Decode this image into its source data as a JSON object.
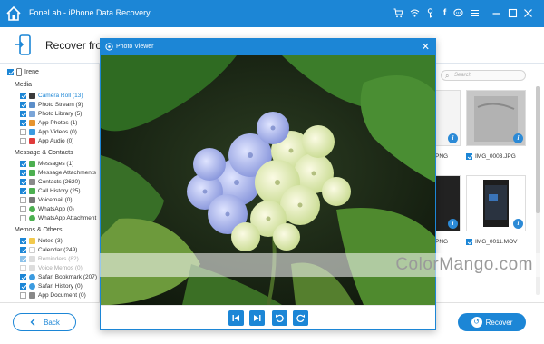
{
  "app": {
    "title": "FoneLab - iPhone Data Recovery"
  },
  "header": {
    "title": "Recover from"
  },
  "device": {
    "name": "Irene"
  },
  "sidebar": {
    "sections": [
      {
        "title": "Media",
        "items": [
          {
            "label": "Camera Roll (13)",
            "checked": true,
            "active": true,
            "color": "#3b3b3b"
          },
          {
            "label": "Photo Stream (9)",
            "checked": true,
            "color": "#5b8ec9"
          },
          {
            "label": "Photo Library (5)",
            "checked": true,
            "color": "#7aa5d8"
          },
          {
            "label": "App Photos (1)",
            "checked": true,
            "color": "#e6942f"
          },
          {
            "label": "App Videos (0)",
            "checked": false,
            "color": "#3b9be0"
          },
          {
            "label": "App Audio (0)",
            "checked": false,
            "color": "#e03b3b"
          }
        ]
      },
      {
        "title": "Message & Contacts",
        "items": [
          {
            "label": "Messages (1)",
            "checked": true,
            "color": "#4caf50"
          },
          {
            "label": "Message Attachments",
            "checked": true,
            "color": "#4caf50"
          },
          {
            "label": "Contacts (2620)",
            "checked": true,
            "color": "#8a8a8a"
          },
          {
            "label": "Call History (25)",
            "checked": true,
            "color": "#4caf50"
          },
          {
            "label": "Voicemail (0)",
            "checked": false,
            "color": "#777777"
          },
          {
            "label": "WhatsApp (0)",
            "checked": false,
            "color": "#4caf50"
          },
          {
            "label": "WhatsApp Attachment",
            "checked": false,
            "color": "#4caf50"
          }
        ]
      },
      {
        "title": "Memos & Others",
        "items": [
          {
            "label": "Notes (3)",
            "checked": true,
            "color": "#f2c94c"
          },
          {
            "label": "Calendar (249)",
            "checked": true,
            "color": "#ffffff"
          },
          {
            "label": "Reminders (82)",
            "checked": true,
            "color": "#cccccc",
            "dim": true
          },
          {
            "label": "Voice Memos (0)",
            "checked": false,
            "color": "#cccccc",
            "dim": true
          },
          {
            "label": "Safari Bookmark (207)",
            "checked": true,
            "color": "#3b9be0"
          },
          {
            "label": "Safari History (0)",
            "checked": true,
            "color": "#3b9be0"
          },
          {
            "label": "App Document (0)",
            "checked": false,
            "color": "#888888"
          }
        ]
      }
    ]
  },
  "search": {
    "placeholder": "Search"
  },
  "thumbnails": [
    {
      "label": "PNG",
      "partial": true
    },
    {
      "label": "IMG_0003.JPG",
      "partial": false
    },
    {
      "label": "PNG",
      "partial": true
    },
    {
      "label": "IMG_0011.MOV",
      "partial": false
    }
  ],
  "viewer": {
    "title": "Photo Viewer"
  },
  "footer": {
    "back_label": "Back",
    "recover_label": "Recover"
  },
  "watermark": {
    "text": "ColorMango.com"
  },
  "colors": {
    "accent": "#1c86d6"
  }
}
